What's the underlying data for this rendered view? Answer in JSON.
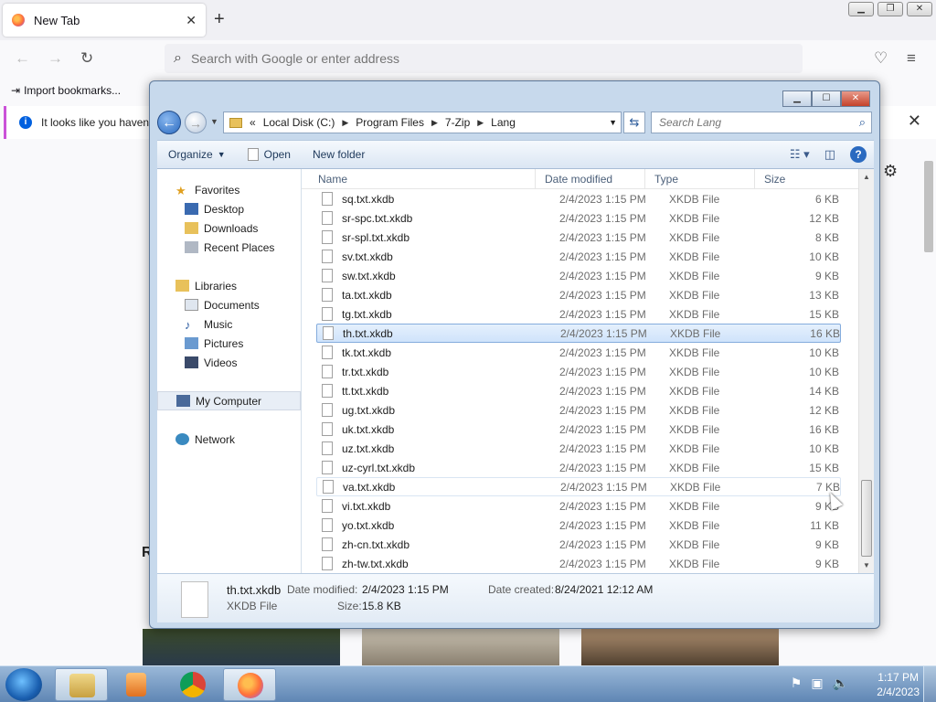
{
  "browser": {
    "tab_title": "New Tab",
    "tab_close": "✕",
    "new_tab": "+",
    "urlbar_placeholder": "Search with Google or enter address",
    "bookmark_import": "Import bookmarks...",
    "notice_text": "It looks like you haven'",
    "notice_close": "✕",
    "r_letter": "R"
  },
  "explorer": {
    "breadcrumb_overflow": "«",
    "breadcrumb": [
      "Local Disk (C:)",
      "Program Files",
      "7-Zip",
      "Lang"
    ],
    "search_placeholder": "Search Lang",
    "toolbar": {
      "organize": "Organize",
      "open": "Open",
      "new_folder": "New folder"
    },
    "nav": {
      "favorites": "Favorites",
      "desktop": "Desktop",
      "downloads": "Downloads",
      "recent_places": "Recent Places",
      "libraries": "Libraries",
      "documents": "Documents",
      "music": "Music",
      "pictures": "Pictures",
      "videos": "Videos",
      "my_computer": "My Computer",
      "network": "Network"
    },
    "columns": {
      "name": "Name",
      "date": "Date modified",
      "type": "Type",
      "size": "Size"
    },
    "files": [
      {
        "name": "sq.txt.xkdb",
        "date": "2/4/2023 1:15 PM",
        "type": "XKDB File",
        "size": "6 KB"
      },
      {
        "name": "sr-spc.txt.xkdb",
        "date": "2/4/2023 1:15 PM",
        "type": "XKDB File",
        "size": "12 KB"
      },
      {
        "name": "sr-spl.txt.xkdb",
        "date": "2/4/2023 1:15 PM",
        "type": "XKDB File",
        "size": "8 KB"
      },
      {
        "name": "sv.txt.xkdb",
        "date": "2/4/2023 1:15 PM",
        "type": "XKDB File",
        "size": "10 KB"
      },
      {
        "name": "sw.txt.xkdb",
        "date": "2/4/2023 1:15 PM",
        "type": "XKDB File",
        "size": "9 KB"
      },
      {
        "name": "ta.txt.xkdb",
        "date": "2/4/2023 1:15 PM",
        "type": "XKDB File",
        "size": "13 KB"
      },
      {
        "name": "tg.txt.xkdb",
        "date": "2/4/2023 1:15 PM",
        "type": "XKDB File",
        "size": "15 KB"
      },
      {
        "name": "th.txt.xkdb",
        "date": "2/4/2023 1:15 PM",
        "type": "XKDB File",
        "size": "16 KB"
      },
      {
        "name": "tk.txt.xkdb",
        "date": "2/4/2023 1:15 PM",
        "type": "XKDB File",
        "size": "10 KB"
      },
      {
        "name": "tr.txt.xkdb",
        "date": "2/4/2023 1:15 PM",
        "type": "XKDB File",
        "size": "10 KB"
      },
      {
        "name": "tt.txt.xkdb",
        "date": "2/4/2023 1:15 PM",
        "type": "XKDB File",
        "size": "14 KB"
      },
      {
        "name": "ug.txt.xkdb",
        "date": "2/4/2023 1:15 PM",
        "type": "XKDB File",
        "size": "12 KB"
      },
      {
        "name": "uk.txt.xkdb",
        "date": "2/4/2023 1:15 PM",
        "type": "XKDB File",
        "size": "16 KB"
      },
      {
        "name": "uz.txt.xkdb",
        "date": "2/4/2023 1:15 PM",
        "type": "XKDB File",
        "size": "10 KB"
      },
      {
        "name": "uz-cyrl.txt.xkdb",
        "date": "2/4/2023 1:15 PM",
        "type": "XKDB File",
        "size": "15 KB"
      },
      {
        "name": "va.txt.xkdb",
        "date": "2/4/2023 1:15 PM",
        "type": "XKDB File",
        "size": "7 KB"
      },
      {
        "name": "vi.txt.xkdb",
        "date": "2/4/2023 1:15 PM",
        "type": "XKDB File",
        "size": "9 KB"
      },
      {
        "name": "yo.txt.xkdb",
        "date": "2/4/2023 1:15 PM",
        "type": "XKDB File",
        "size": "11 KB"
      },
      {
        "name": "zh-cn.txt.xkdb",
        "date": "2/4/2023 1:15 PM",
        "type": "XKDB File",
        "size": "9 KB"
      },
      {
        "name": "zh-tw.txt.xkdb",
        "date": "2/4/2023 1:15 PM",
        "type": "XKDB File",
        "size": "9 KB"
      }
    ],
    "selected_file": "th.txt.xkdb",
    "details": {
      "name": "th.txt.xkdb",
      "type": "XKDB File",
      "date_modified_label": "Date modified:",
      "date_modified": "2/4/2023 1:15 PM",
      "date_created_label": "Date created:",
      "date_created": "8/24/2021 12:12 AM",
      "size_label": "Size:",
      "size": "15.8 KB"
    }
  },
  "taskbar": {
    "time": "1:17 PM",
    "date": "2/4/2023"
  },
  "colors": {
    "selection": "#cfe3fb",
    "taskbar": "#5f86b4",
    "firefox_accent": "#ff7139"
  }
}
